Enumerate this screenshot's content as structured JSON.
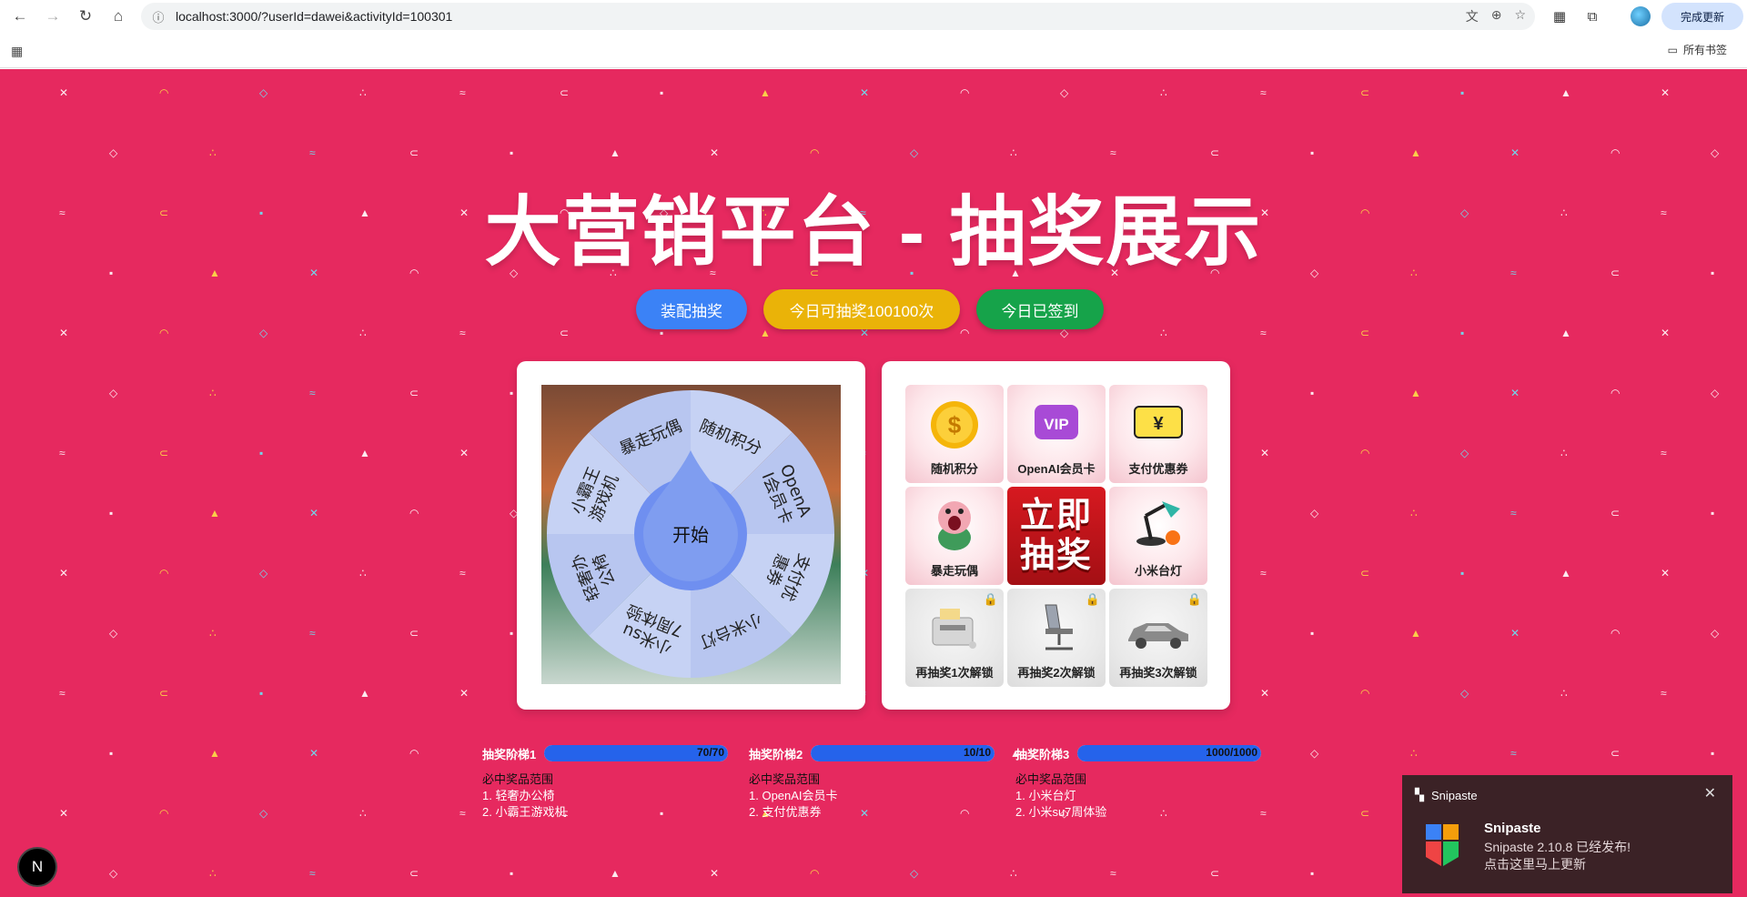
{
  "browser": {
    "url": "localhost:3000/?userId=dawei&activityId=100301",
    "update_label": "完成更新",
    "bookmarks_folder": "所有书签"
  },
  "page": {
    "title": "大营销平台 - 抽奖展示",
    "buttons": {
      "assemble": "装配抽奖",
      "draws_today": "今日可抽奖100100次",
      "signed_in": "今日已签到"
    }
  },
  "wheel": {
    "start_label": "开始",
    "segments": [
      "随机积分",
      "OpenAI会员卡",
      "支付优惠券",
      "小米台灯",
      "小米su7周体验",
      "轻奢办公椅",
      "小霸王游戏机",
      "暴走玩偶"
    ]
  },
  "grid": {
    "cells": [
      {
        "label": "随机积分",
        "icon": "coin-icon"
      },
      {
        "label": "OpenAI会员卡",
        "icon": "vip-icon"
      },
      {
        "label": "支付优惠券",
        "icon": "coupon-icon"
      },
      {
        "label": "暴走玩偶",
        "icon": "doll-icon"
      },
      {
        "label": "立即抽奖",
        "icon": "draw-now"
      },
      {
        "label": "小米台灯",
        "icon": "lamp-icon"
      },
      {
        "label": "再抽奖1次解锁",
        "icon": "game-console-icon"
      },
      {
        "label": "再抽奖2次解锁",
        "icon": "office-chair-icon"
      },
      {
        "label": "再抽奖3次解锁",
        "icon": "car-icon"
      }
    ],
    "center_line1": "立即",
    "center_line2": "抽奖"
  },
  "stages": [
    {
      "label": "抽奖阶梯1",
      "progress": "70/70",
      "fraction": 1.0,
      "range_title": "必中奖品范围",
      "items": [
        "1. 轻奢办公椅",
        "2. 小霸王游戏机"
      ]
    },
    {
      "label": "抽奖阶梯2",
      "progress": "10/10",
      "fraction": 1.0,
      "range_title": "必中奖品范围",
      "items": [
        "1. OpenAI会员卡",
        "2. 支付优惠券"
      ]
    },
    {
      "label": "抽奖阶梯3",
      "progress": "1000/1000",
      "fraction": 1.0,
      "range_title": "必中奖品范围",
      "items": [
        "1. 小米台灯",
        "2. 小米su7周体验"
      ]
    }
  ],
  "badge": "N",
  "toast": {
    "app": "Snipaste",
    "title": "Snipaste",
    "line1": "Snipaste 2.10.8 已经发布!",
    "line2": "点击这里马上更新"
  },
  "colors": {
    "page_bg": "#e6295f",
    "blue": "#3b82f6",
    "yellow": "#eab308",
    "green": "#16a34a",
    "wheel_segment": "#b8c6f0",
    "wheel_center": "#7f9df0"
  }
}
